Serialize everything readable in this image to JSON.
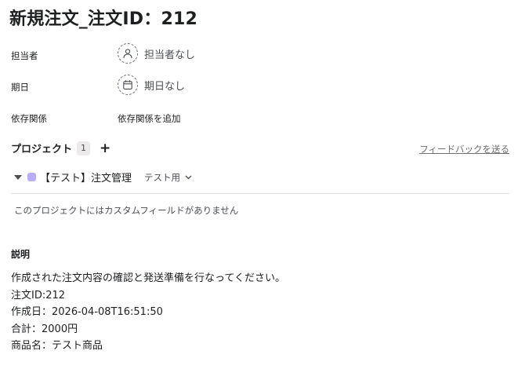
{
  "task": {
    "title": "新規注文_注文ID：212"
  },
  "fields": {
    "assignee": {
      "label": "担当者",
      "value": "担当者なし",
      "icon": "person-icon"
    },
    "due_date": {
      "label": "期日",
      "value": "期日なし",
      "icon": "calendar-icon"
    },
    "dependencies": {
      "label": "依存関係",
      "value": "依存関係を追加"
    }
  },
  "projects": {
    "heading": "プロジェクト",
    "count": "1",
    "add_symbol": "+",
    "feedback_link": "フィードバックを送る",
    "items": [
      {
        "name": "【テスト】注文管理",
        "color": "#b8aefc",
        "section": "テスト用"
      }
    ],
    "no_custom_fields": "このプロジェクトにはカスタムフィールドがありません"
  },
  "description": {
    "heading": "説明",
    "lines": [
      "作成された注文内容の確認と発送準備を行なってください。",
      "注文ID:212",
      "作成日：2026-04-08T16:51:50",
      "合計：2000円",
      "商品名：テスト商品"
    ]
  }
}
